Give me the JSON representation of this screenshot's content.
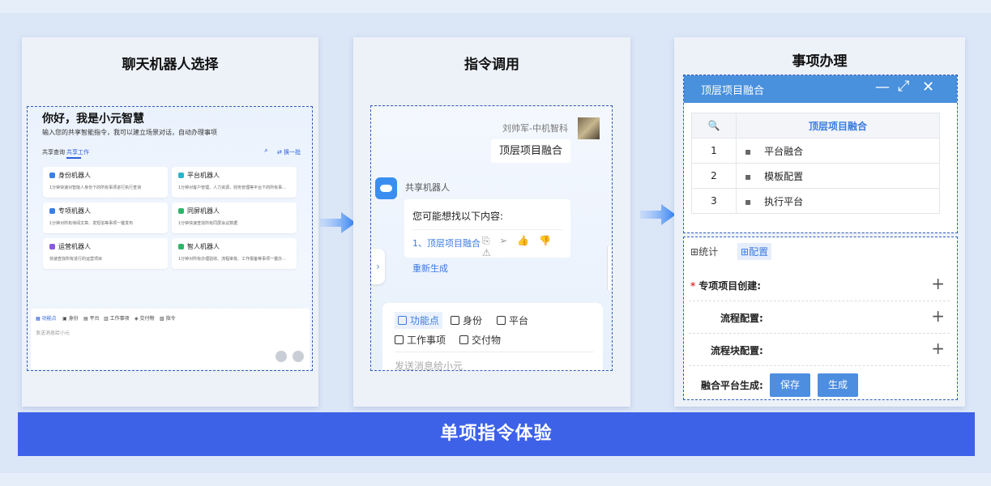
{
  "panels": {
    "p1": {
      "title": "聊天机器人选择",
      "greeting": "你好，我是小元智慧",
      "subtitle": "输入您的共享智能指令，我可以建立场景对话，自动办理事项",
      "tabs": [
        "共享查询",
        "共享工作"
      ],
      "search_refresh": "换一批",
      "cards": [
        {
          "title": "身份机器人",
          "desc": "1分钟快速对智能人身份下的所有事项进行执行查询"
        },
        {
          "title": "平台机器人",
          "desc": "1分钟对客户管理、人力资源、财务管理等平台下的所有事..."
        },
        {
          "title": "专项机器人",
          "desc": "1分钟对所有待阅文章、发短信等事项一键发布"
        },
        {
          "title": "同屏机器人",
          "desc": "1分钟快速查找所有同屏会议数据"
        },
        {
          "title": "运营机器人",
          "desc": "快速查找所有进行的运营项目"
        },
        {
          "title": "智人机器人",
          "desc": "1分钟对所有办理验收、流程审批、工作报备等事项一键办..."
        }
      ],
      "tools": [
        "功能点",
        "身份",
        "平台",
        "工作事项",
        "交付物",
        "指令"
      ],
      "input_placeholder": "发送消息给小元"
    },
    "p2": {
      "title": "指令调用",
      "user_name": "刘帅军-中机智科",
      "user_message": "顶层项目融合",
      "bot_name": "共享机器人",
      "bot_question": "您可能想找以下内容:",
      "bot_link": "1、顶层项目融合",
      "bot_actions": "⎘ ➢ 👍 👎 ⚠",
      "regenerate": "重新生成",
      "collapse_icon": "›",
      "tools": [
        "功能点",
        "身份",
        "平台",
        "工作事项",
        "交付物"
      ],
      "input_placeholder": "发送消息给小元"
    },
    "p3": {
      "title": "事项办理",
      "dialog_title": "顶层项目融合",
      "table_header": "顶层项目融合",
      "search_icon": "🔍",
      "rows": [
        {
          "num": "1",
          "name": "平台融合"
        },
        {
          "num": "2",
          "name": "模板配置"
        },
        {
          "num": "3",
          "name": "执行平台"
        }
      ],
      "tabs": [
        "统计",
        "配置"
      ],
      "fields": [
        {
          "label": "专项项目创建:",
          "required": true
        },
        {
          "label": "流程配置:",
          "required": false
        },
        {
          "label": "流程块配置:",
          "required": false
        }
      ],
      "generate_label": "融合平台生成:",
      "save_button": "保存",
      "generate_button": "生成"
    }
  },
  "footer": "单项指令体验",
  "colors": {
    "accent": "#3d62e8",
    "link": "#3b7be0",
    "dialog_header": "#4990dd",
    "dash": "#2d5fb8"
  }
}
